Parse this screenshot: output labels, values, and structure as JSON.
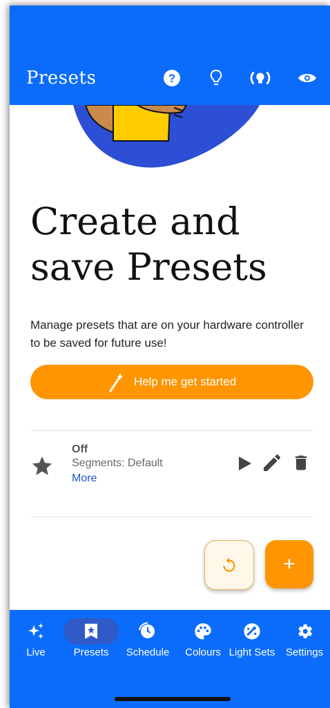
{
  "appbar": {
    "title": "Presets",
    "icons": [
      "help-icon",
      "lightbulb-icon",
      "broadcast-icon",
      "eye-icon"
    ]
  },
  "intro": {
    "heading": "Create and save Presets",
    "description": "Manage presets that are on your hardware controller to be saved for future use!",
    "help_button": "Help me get started"
  },
  "presets": [
    {
      "name": "Off",
      "segments": "Segments: Default",
      "more": "More"
    }
  ],
  "fabs": {
    "refresh": "refresh-icon",
    "add": "+"
  },
  "nav": {
    "items": [
      {
        "label": "Live",
        "icon": "sparkles-icon"
      },
      {
        "label": "Presets",
        "icon": "bookmark-star-icon",
        "active": true
      },
      {
        "label": "Schedule",
        "icon": "clock-icon"
      },
      {
        "label": "Colours",
        "icon": "palette-icon"
      },
      {
        "label": "Light Sets",
        "icon": "gauge-icon"
      },
      {
        "label": "Settings",
        "icon": "gear-icon"
      }
    ]
  },
  "colors": {
    "primary": "#0b6cfb",
    "accent": "#ff9500",
    "link": "#1a55d6"
  }
}
